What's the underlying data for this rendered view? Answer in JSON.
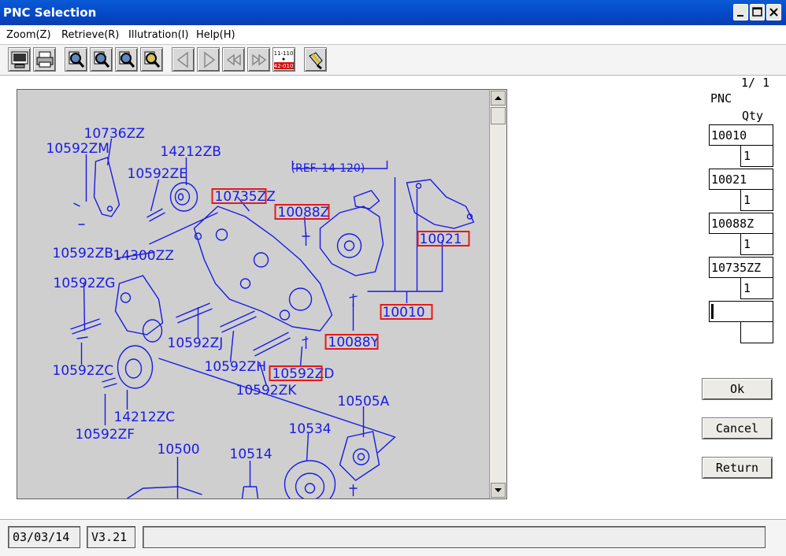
{
  "window": {
    "title": "PNC Selection"
  },
  "menu": [
    "Zoom(Z)",
    "Retrieve(R)",
    "Illutration(I)",
    "Help(H)"
  ],
  "toolbar": {
    "page_badge_top": "11-110",
    "page_badge_bottom": "42-010"
  },
  "diagram": {
    "ref": "(REF. 14-120)",
    "labels": [
      "10736ZZ",
      "10592ZM",
      "14212ZB",
      "10592ZE",
      "10735ZZ",
      "10088Z",
      "10021",
      "10592ZB",
      "14300ZZ",
      "10592ZG",
      "10010",
      "10592ZJ",
      "10088Y",
      "10592ZC",
      "10592ZH",
      "10592ZD",
      "10592ZK",
      "14212ZC",
      "10592ZF",
      "10505A",
      "10534",
      "10500",
      "10514"
    ],
    "highlighted": [
      "10735ZZ",
      "10088Z",
      "10021",
      "10010",
      "10088Y",
      "10592ZD"
    ],
    "line_color": "#1a1ae6",
    "highlight_color": "#e61919"
  },
  "side": {
    "page": "1/ 1",
    "pnc_label": "PNC",
    "qty_label": "Qty",
    "rows": [
      {
        "pnc": "10010",
        "qty": "1"
      },
      {
        "pnc": "10021",
        "qty": "1"
      },
      {
        "pnc": "10088Z",
        "qty": "1"
      },
      {
        "pnc": "10735ZZ",
        "qty": "1"
      }
    ]
  },
  "buttons": {
    "ok": "Ok",
    "cancel": "Cancel",
    "return": "Return"
  },
  "status": {
    "date": "03/03/14",
    "version": "V3.21",
    "message": ""
  }
}
